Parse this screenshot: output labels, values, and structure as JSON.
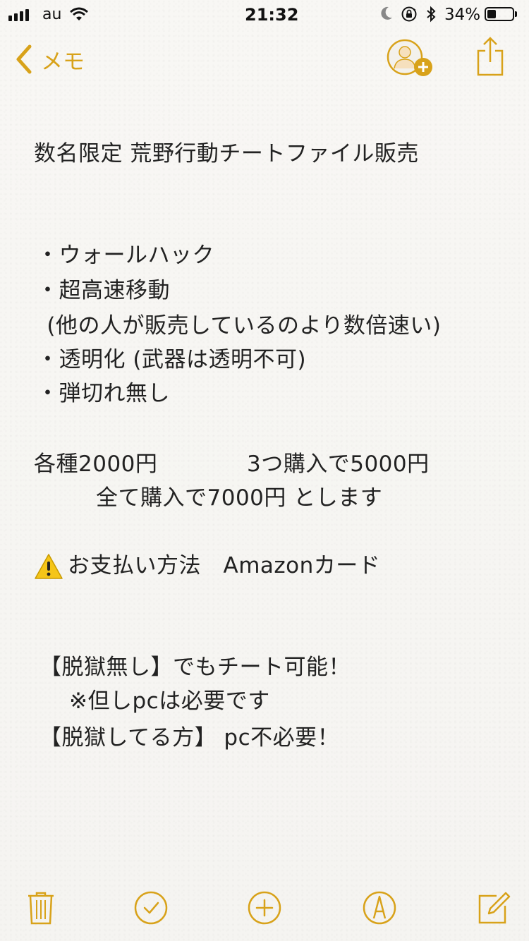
{
  "status_bar": {
    "carrier": "au",
    "time": "21:32",
    "battery_percent": "34%",
    "battery_level": 0.34,
    "signal_bars": 4
  },
  "nav": {
    "back_label": "メモ",
    "icons": {
      "back": "chevron-left-icon",
      "collaborate": "add-person-icon",
      "share": "share-icon"
    }
  },
  "note": {
    "title": "数名限定 荒野行動チートファイル販売",
    "features": [
      "・ウォールハック",
      "・超高速移動",
      " (他の人が販売しているのより数倍速い)",
      "・透明化 (武器は透明不可)",
      "・弾切れ無し"
    ],
    "price_line_1_left": "各種2000円",
    "price_line_1_right": "3つ購入で5000円",
    "price_line_2": "全て購入で7000円 とします",
    "payment": "お支払い方法　Amazonカード",
    "jailbreak": [
      "【脱獄無し】でもチート可能！",
      "※但しpcは必要です",
      "【脱獄してる方】 pc不必要！"
    ]
  },
  "toolbar": {
    "icons": [
      "trash-icon",
      "checklist-icon",
      "add-icon",
      "markup-icon",
      "compose-icon"
    ]
  },
  "colors": {
    "accent": "#d8a21a",
    "text": "#222222",
    "background": "#f7f6f3",
    "warning_yellow": "#f5c518"
  }
}
